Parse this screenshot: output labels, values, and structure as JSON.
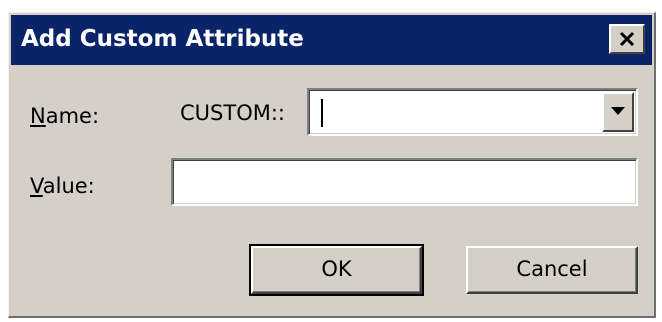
{
  "dialog": {
    "title": "Add Custom Attribute",
    "close_icon": "close-icon"
  },
  "form": {
    "name_label": "Name:",
    "name_label_mnemonic": "N",
    "name_prefix": "CUSTOM::",
    "name_value": "",
    "dropdown_icon": "chevron-down-icon",
    "value_label": "Value:",
    "value_label_mnemonic": "V",
    "value_value": ""
  },
  "buttons": {
    "ok_label": "OK",
    "cancel_label": "Cancel"
  }
}
